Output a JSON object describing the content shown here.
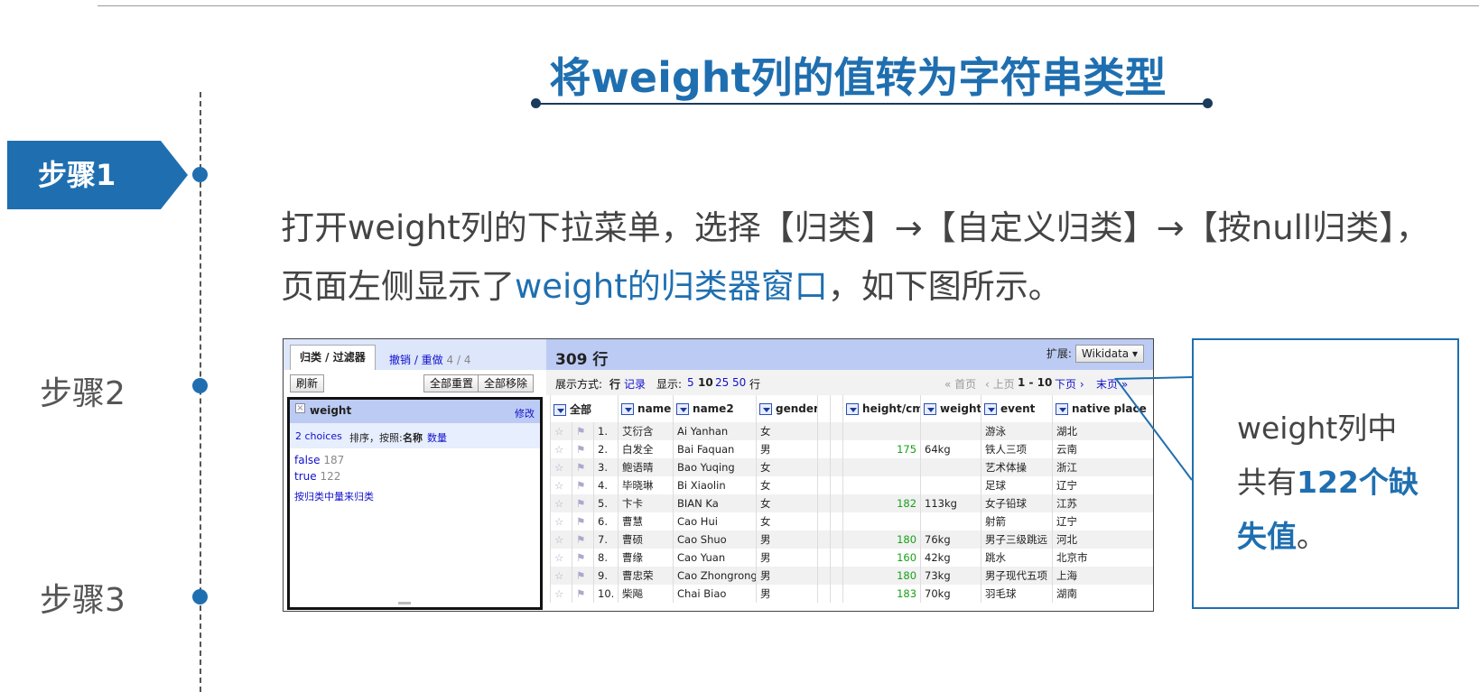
{
  "slide": {
    "title": "将weight列的值转为字符串类型",
    "steps": [
      {
        "label": "步骤1",
        "active": true
      },
      {
        "label": "步骤2",
        "active": false
      },
      {
        "label": "步骤3",
        "active": false
      }
    ],
    "para_line1": "打开weight列的下拉菜单，选择【归类】→【自定义归类】→【按null归类】，",
    "para_line2_a": "页面左侧显示了",
    "para_line2_hl": "weight的归类器窗口",
    "para_line2_b": "，如下图所示。",
    "callout": {
      "line1": "weight列中",
      "line2_a": "共有",
      "line2_hl": "122个缺",
      "line3_hl": "失值",
      "line3_b": "。"
    },
    "accent_color": "#1f6fb0"
  },
  "left_panel": {
    "tab_label": "归类 / 过滤器",
    "undo_label": "撤销 / 重做",
    "undo_count": "4 / 4",
    "refresh_button": "刷新",
    "reset_all_button": "全部重置",
    "remove_all_button": "全部移除",
    "facet": {
      "column_name": "weight",
      "edit_link": "修改",
      "choices": "2 choices",
      "sort_by": "排序，按照:",
      "sort_name": "名称",
      "sort_count": "数量",
      "items": [
        {
          "label": "false",
          "count": "187"
        },
        {
          "label": "true",
          "count": "122"
        }
      ],
      "cluster_link": "按归类中量来归类"
    }
  },
  "right_panel": {
    "rows_label": "309 行",
    "extensions_label": "扩展:",
    "extensions_button": "Wikidata ▾",
    "show_as_label": "展示方式:",
    "show_as_rows": "行",
    "show_as_records": "记录",
    "display_label": "显示:",
    "page_sizes": [
      "5",
      "10",
      "25",
      "50"
    ],
    "page_size_selected": "10",
    "rows_suffix": "行",
    "pager_first": "« 首页",
    "pager_prev": "‹ 上页",
    "pager_range": "1 - 10",
    "pager_next": "下页 ›",
    "pager_last": "末页 »",
    "all_column": "全部",
    "columns": [
      "name",
      "name2",
      "gender",
      "height/cm",
      "weight",
      "event",
      "native place"
    ],
    "rows": [
      {
        "idx": "1.",
        "name": "艾衍含",
        "name2": "Ai Yanhan",
        "gender": "女",
        "height": "",
        "weight": "",
        "event": "游泳",
        "place": "湖北"
      },
      {
        "idx": "2.",
        "name": "白发全",
        "name2": "Bai Faquan",
        "gender": "男",
        "height": "175",
        "weight": "64kg",
        "event": "铁人三项",
        "place": "云南"
      },
      {
        "idx": "3.",
        "name": "鲍语晴",
        "name2": "Bao Yuqing",
        "gender": "女",
        "height": "",
        "weight": "",
        "event": "艺术体操",
        "place": "浙江"
      },
      {
        "idx": "4.",
        "name": "毕晓琳",
        "name2": "Bi Xiaolin",
        "gender": "女",
        "height": "",
        "weight": "",
        "event": "足球",
        "place": "辽宁"
      },
      {
        "idx": "5.",
        "name": "卞卡",
        "name2": "BIAN Ka",
        "gender": "女",
        "height": "182",
        "weight": "113kg",
        "event": "女子铅球",
        "place": "江苏"
      },
      {
        "idx": "6.",
        "name": "曹慧",
        "name2": "Cao Hui",
        "gender": "女",
        "height": "",
        "weight": "",
        "event": "射箭",
        "place": "辽宁"
      },
      {
        "idx": "7.",
        "name": "曹硕",
        "name2": "Cao Shuo",
        "gender": "男",
        "height": "180",
        "weight": "76kg",
        "event": "男子三级跳远",
        "place": "河北"
      },
      {
        "idx": "8.",
        "name": "曹缘",
        "name2": "Cao Yuan",
        "gender": "男",
        "height": "160",
        "weight": "42kg",
        "event": "跳水",
        "place": "北京市"
      },
      {
        "idx": "9.",
        "name": "曹忠荣",
        "name2": "Cao Zhongrong",
        "gender": "男",
        "height": "180",
        "weight": "73kg",
        "event": "男子现代五项",
        "place": "上海"
      },
      {
        "idx": "10.",
        "name": "柴飚",
        "name2": "Chai Biao",
        "gender": "男",
        "height": "183",
        "weight": "70kg",
        "event": "羽毛球",
        "place": "湖南"
      }
    ]
  }
}
